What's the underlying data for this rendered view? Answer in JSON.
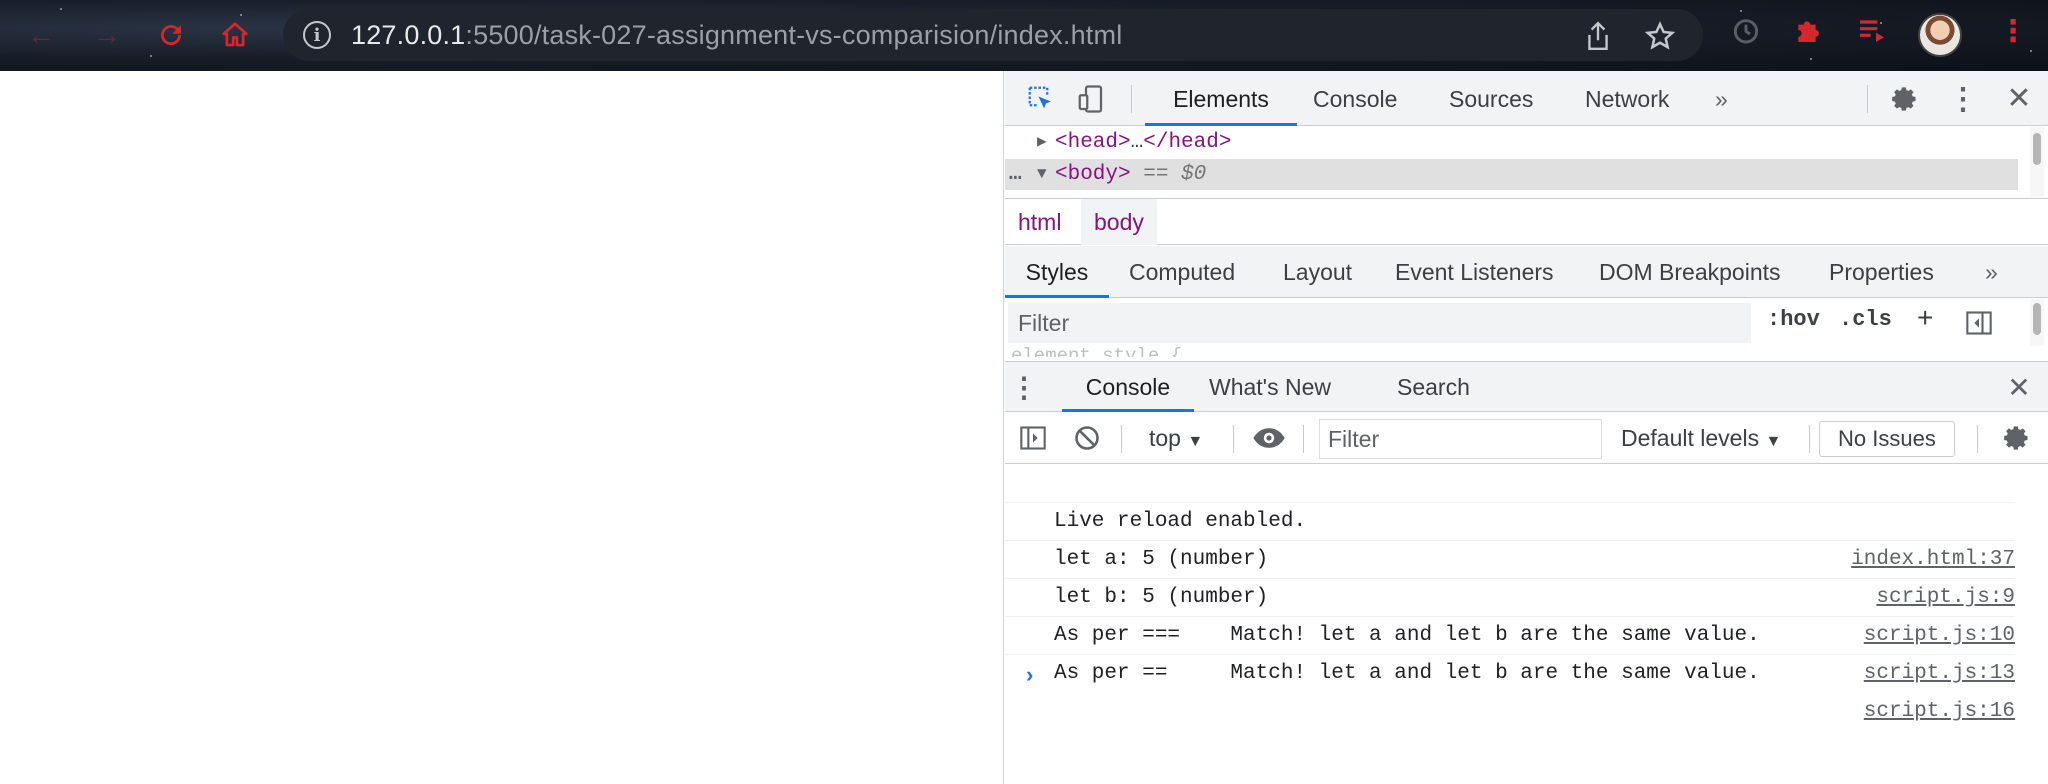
{
  "browser": {
    "url_host": "127.0.0.1",
    "url_rest": ":5500/task-027-assignment-vs-comparision/index.html",
    "icons": [
      "back-icon",
      "forward-icon",
      "reload-icon",
      "home-icon",
      "info-icon",
      "share-icon",
      "star-icon",
      "history-icon",
      "puzzle-icon",
      "playlist-icon",
      "avatar",
      "menu-icon"
    ]
  },
  "devtools": {
    "main_tabs": [
      {
        "label": "Elements",
        "active": true
      },
      {
        "label": "Console",
        "active": false
      },
      {
        "label": "Sources",
        "active": false
      },
      {
        "label": "Network",
        "active": false
      }
    ],
    "more_tabs": "»",
    "dom_tree": {
      "head": {
        "open": "<head>",
        "ellipsis": "…",
        "close": "</head>"
      },
      "body": {
        "prefix": "…",
        "open": "<body>",
        "eq": "== $0"
      }
    },
    "breadcrumbs": [
      "html",
      "body"
    ],
    "styles_tabs": [
      {
        "label": "Styles",
        "active": true
      },
      {
        "label": "Computed",
        "active": false
      },
      {
        "label": "Layout",
        "active": false
      },
      {
        "label": "Event Listeners",
        "active": false
      },
      {
        "label": "DOM Breakpoints",
        "active": false
      },
      {
        "label": "Properties",
        "active": false
      }
    ],
    "styles_filter": {
      "placeholder": "Filter"
    },
    "hov_label": ":hov",
    "cls_label": ".cls",
    "plus_label": "+",
    "element_style_peek": "element.style {",
    "drawer_tabs": [
      {
        "label": "Console",
        "active": true
      },
      {
        "label": "What's New",
        "active": false
      },
      {
        "label": "Search",
        "active": false
      }
    ],
    "console_toolbar": {
      "context": "top",
      "filter_placeholder": "Filter",
      "levels": "Default levels",
      "issues": "No Issues"
    },
    "console_messages": [
      {
        "text": "Live reload enabled.",
        "source": "index.html:37"
      },
      {
        "text": "let a: 5 (number)",
        "source": "script.js:9"
      },
      {
        "text": "let b: 5 (number)",
        "source": "script.js:10"
      },
      {
        "text": "As per ===    Match! let a and let b are the same value.",
        "source": "script.js:13"
      },
      {
        "text": "As per ==     Match! let a and let b are the same value.",
        "source": "script.js:16"
      }
    ],
    "prompt": "›",
    "colors": {
      "accent": "#1a73e8",
      "tag": "#881280",
      "chrome_red": "#d4272e"
    }
  }
}
